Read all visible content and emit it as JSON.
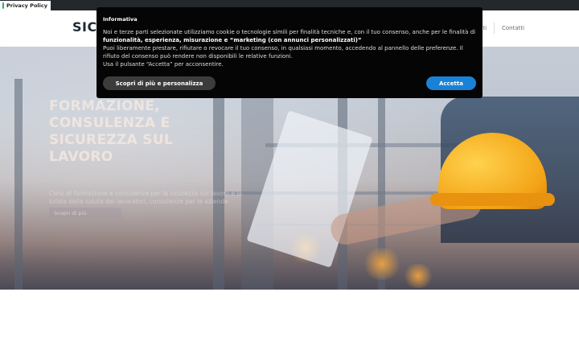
{
  "privacy_tab": {
    "label": "Privacy Policy"
  },
  "header": {
    "logo": "SICU",
    "nav": [
      "nti",
      "Contatti"
    ]
  },
  "hero": {
    "title": "Formazione, consulenza e sicurezza sul lavoro",
    "subtitle": "Corsi di formazione e consulenza per la sicurezza sul lavoro e la tutela della salute dei lavoratori, consulenze per le aziende",
    "button_label": "Scopri di più"
  },
  "cookie_modal": {
    "title": "Informativa",
    "line1_start": "Noi e terze parti selezionate utilizziamo cookie o tecnologie simili per finalità tecniche e, con il tuo consenso, anche per le finalità di ",
    "line1_bold": "funzionalità, esperienza, misurazione e “marketing (con annunci personalizzati)”",
    "line2": "Puoi liberamente prestare, rifiutare o revocare il tuo consenso, in qualsiasi momento, accedendo al pannello delle preferenze. Il rifiuto del consenso può rendere non disponibili le relative funzioni.",
    "line3": "Usa il pulsante “Accetta” per acconsentire.",
    "more_button": "Scopri di più e personalizza",
    "accept_button": "Accetta"
  },
  "colors": {
    "topbar": "#23282d",
    "modal_bg": "#050505",
    "accept": "#1a82d6",
    "more": "#3c3c3c",
    "privacy_accent": "#26b36b"
  }
}
